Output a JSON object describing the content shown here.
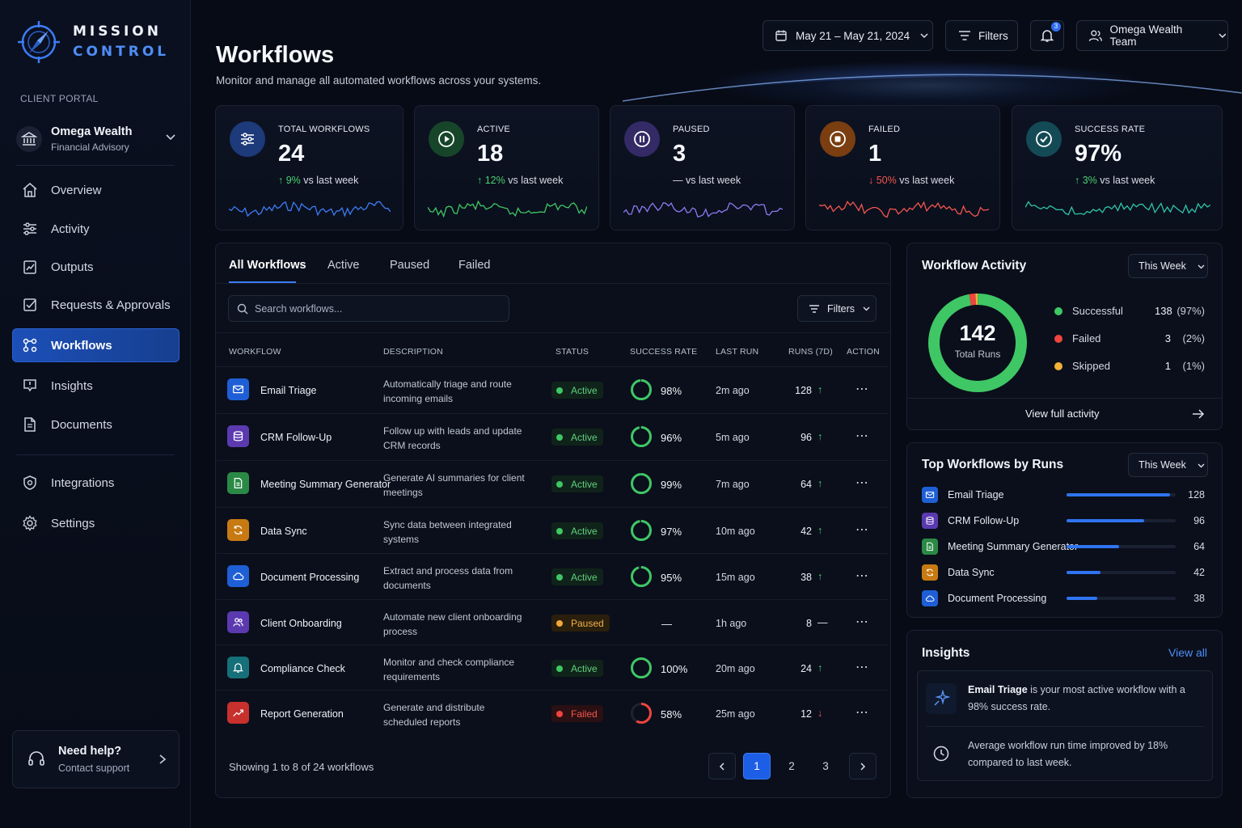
{
  "brand": {
    "line1": "MISSION",
    "line2": "CONTROL"
  },
  "sidebar": {
    "section_label": "CLIENT PORTAL",
    "client_name": "Omega Wealth",
    "client_sub": "Financial Advisory",
    "items": [
      {
        "label": "Overview",
        "icon": "home-icon"
      },
      {
        "label": "Activity",
        "icon": "sliders-icon"
      },
      {
        "label": "Outputs",
        "icon": "chart-file-icon"
      },
      {
        "label": "Requests & Approvals",
        "icon": "checkbox-icon"
      },
      {
        "label": "Workflows",
        "icon": "workflow-icon",
        "active": true
      },
      {
        "label": "Insights",
        "icon": "insight-icon"
      },
      {
        "label": "Documents",
        "icon": "document-icon"
      },
      {
        "label": "Integrations",
        "icon": "integration-icon"
      },
      {
        "label": "Settings",
        "icon": "gear-icon"
      }
    ],
    "help_title": "Need help?",
    "help_sub": "Contact support"
  },
  "header": {
    "title": "Workflows",
    "subtitle": "Monitor and manage all automated workflows across your systems.",
    "date_range": "May 21 – May 21, 2024",
    "filters_label": "Filters",
    "notification_count": "3",
    "team_label": "Omega Wealth Team"
  },
  "stats": [
    {
      "label": "TOTAL WORKFLOWS",
      "value": "24",
      "trend": "9%",
      "trend_dir": "up",
      "suffix": "vs last week",
      "color": "#3d7cf5"
    },
    {
      "label": "ACTIVE",
      "value": "18",
      "trend": "12%",
      "trend_dir": "up",
      "suffix": "vs last week",
      "color": "#3fc765"
    },
    {
      "label": "PAUSED",
      "value": "3",
      "trend": "—",
      "trend_dir": "flat",
      "suffix": "vs last week",
      "color": "#8b7cf0"
    },
    {
      "label": "FAILED",
      "value": "1",
      "trend": "50%",
      "trend_dir": "down",
      "suffix": "vs last week",
      "color": "#f2554f"
    },
    {
      "label": "SUCCESS RATE",
      "value": "97%",
      "trend": "3%",
      "trend_dir": "up",
      "suffix": "vs last week",
      "color": "#2fc4a8"
    }
  ],
  "tabs": [
    "All Workflows",
    "Active",
    "Paused",
    "Failed"
  ],
  "search_placeholder": "Search workflows...",
  "table_filters_label": "Filters",
  "columns": [
    "WORKFLOW",
    "DESCRIPTION",
    "STATUS",
    "SUCCESS RATE",
    "LAST RUN",
    "RUNS (7D)",
    "ACTION"
  ],
  "rows": [
    {
      "name": "Email Triage",
      "desc": "Automatically triage and route incoming emails",
      "status": "Active",
      "rate": "98%",
      "rate_value": 98,
      "last_run": "2m ago",
      "runs": "128",
      "trend": "up",
      "icon": "mail-icon",
      "icon_bg": "#1f5fd6"
    },
    {
      "name": "CRM Follow-Up",
      "desc": "Follow up with leads and update CRM records",
      "status": "Active",
      "rate": "96%",
      "rate_value": 96,
      "last_run": "5m ago",
      "runs": "96",
      "trend": "up",
      "icon": "database-icon",
      "icon_bg": "#5b3ab0"
    },
    {
      "name": "Meeting Summary Generator",
      "desc": "Generate AI summaries for client meetings",
      "status": "Active",
      "rate": "99%",
      "rate_value": 99,
      "last_run": "7m ago",
      "runs": "64",
      "trend": "up",
      "icon": "file-text-icon",
      "icon_bg": "#2a8a45"
    },
    {
      "name": "Data Sync",
      "desc": "Sync data between integrated systems",
      "status": "Active",
      "rate": "97%",
      "rate_value": 97,
      "last_run": "10m ago",
      "runs": "42",
      "trend": "up",
      "icon": "sync-icon",
      "icon_bg": "#c87a12"
    },
    {
      "name": "Document Processing",
      "desc": "Extract and process data from documents",
      "status": "Active",
      "rate": "95%",
      "rate_value": 95,
      "last_run": "15m ago",
      "runs": "38",
      "trend": "up",
      "icon": "cloud-icon",
      "icon_bg": "#1f5fd6"
    },
    {
      "name": "Client Onboarding",
      "desc": "Automate new client onboarding process",
      "status": "Paused",
      "rate": "—",
      "rate_value": null,
      "last_run": "1h ago",
      "runs": "8",
      "trend": "flat",
      "icon": "users-icon",
      "icon_bg": "#5b3ab0"
    },
    {
      "name": "Compliance Check",
      "desc": "Monitor and check compliance requirements",
      "status": "Active",
      "rate": "100%",
      "rate_value": 100,
      "last_run": "20m ago",
      "runs": "24",
      "trend": "up",
      "icon": "bell-icon",
      "icon_bg": "#16707a"
    },
    {
      "name": "Report Generation",
      "desc": "Generate and distribute scheduled reports",
      "status": "Failed",
      "rate": "58%",
      "rate_value": 58,
      "last_run": "25m ago",
      "runs": "12",
      "trend": "down",
      "icon": "trend-chart-icon",
      "icon_bg": "#c7302c"
    }
  ],
  "pagination": {
    "showing": "Showing 1 to 8 of 24 workflows",
    "pages": [
      "1",
      "2",
      "3"
    ],
    "current": "1"
  },
  "activity": {
    "title": "Workflow Activity",
    "period": "This Week",
    "total": "142",
    "total_label": "Total Runs",
    "legend": [
      {
        "label": "Successful",
        "value": "138",
        "pct": "(97%)",
        "color": "#3fc765"
      },
      {
        "label": "Failed",
        "value": "3",
        "pct": "(2%)",
        "color": "#f0443e"
      },
      {
        "label": "Skipped",
        "value": "1",
        "pct": "(1%)",
        "color": "#f2b13a"
      }
    ],
    "link": "View full activity"
  },
  "top_workflows": {
    "title": "Top Workflows by Runs",
    "period": "This Week",
    "max": 128,
    "items": [
      {
        "name": "Email Triage",
        "value": "128",
        "runs": 128,
        "icon": "mail-icon",
        "icon_bg": "#1f5fd6"
      },
      {
        "name": "CRM Follow-Up",
        "value": "96",
        "runs": 96,
        "icon": "database-icon",
        "icon_bg": "#5b3ab0"
      },
      {
        "name": "Meeting Summary Generator",
        "value": "64",
        "runs": 64,
        "icon": "file-text-icon",
        "icon_bg": "#2a8a45"
      },
      {
        "name": "Data Sync",
        "value": "42",
        "runs": 42,
        "icon": "sync-icon",
        "icon_bg": "#c87a12"
      },
      {
        "name": "Document Processing",
        "value": "38",
        "runs": 38,
        "icon": "cloud-icon",
        "icon_bg": "#1f5fd6"
      }
    ]
  },
  "insights": {
    "title": "Insights",
    "view_all": "View all",
    "item1_bold": "Email Triage",
    "item1_rest": " is your most active workflow with a 98% success rate.",
    "item2": "Average workflow run time improved by 18% compared to last week."
  }
}
